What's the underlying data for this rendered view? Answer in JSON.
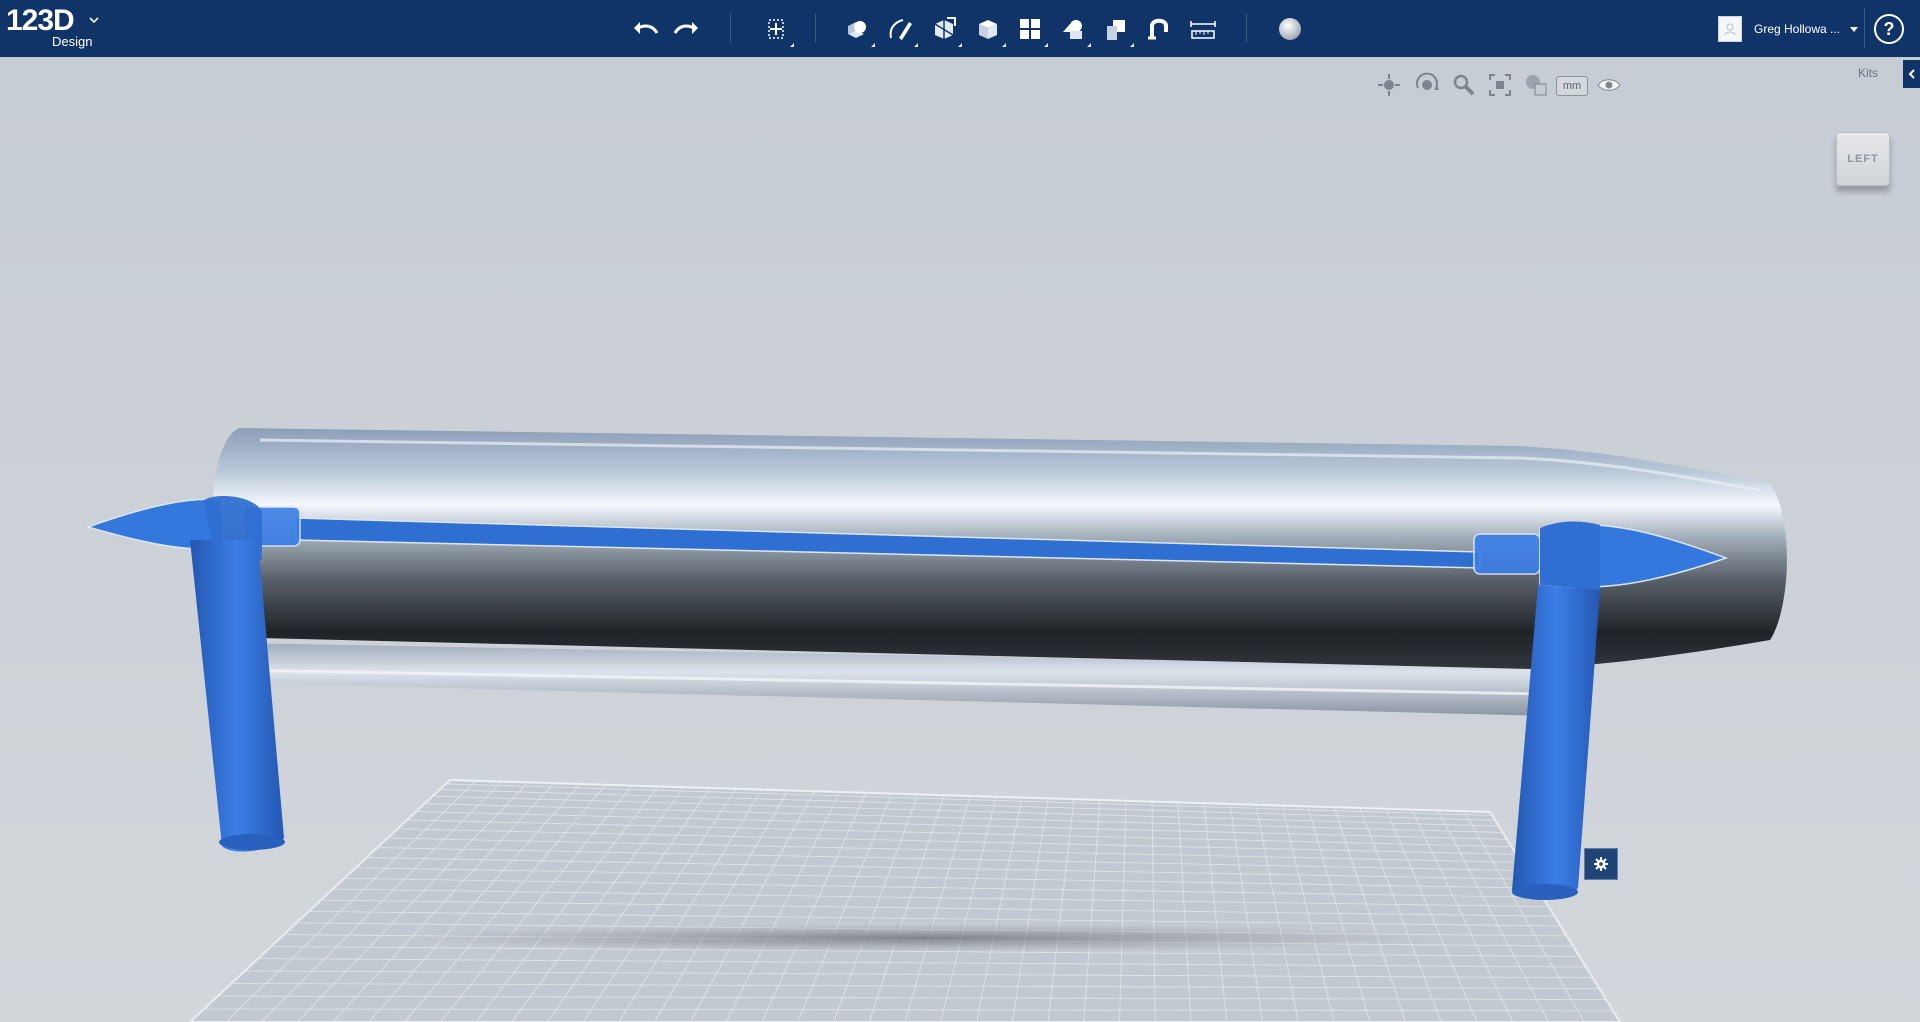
{
  "app": {
    "logo_text": "123D",
    "logo_sub": "Design"
  },
  "toolbar": {
    "items": [
      {
        "name": "undo-button",
        "icon": "undo-icon"
      },
      {
        "name": "redo-button",
        "icon": "redo-icon"
      },
      {
        "name": "transform-button",
        "icon": "transform-icon"
      },
      {
        "name": "primitives-button",
        "icon": "primitives-icon"
      },
      {
        "name": "sketch-button",
        "icon": "sketch-icon"
      },
      {
        "name": "construct-button",
        "icon": "construct-icon"
      },
      {
        "name": "modify-button",
        "icon": "modify-icon"
      },
      {
        "name": "pattern-button",
        "icon": "pattern-icon"
      },
      {
        "name": "grouping-button",
        "icon": "grouping-icon"
      },
      {
        "name": "combine-button",
        "icon": "combine-icon"
      },
      {
        "name": "snap-button",
        "icon": "snap-icon"
      },
      {
        "name": "measure-button",
        "icon": "measure-icon"
      },
      {
        "name": "material-button",
        "icon": "material-sphere-icon"
      }
    ]
  },
  "user": {
    "name": "Greg Hollowa ..."
  },
  "help_label": "?",
  "navbar": {
    "items": [
      "pan-icon",
      "orbit-icon",
      "zoom-icon",
      "fit-icon",
      "view-mode-icon",
      "visibility-icon"
    ],
    "units_label": "mm"
  },
  "kits": {
    "label": "Kits"
  },
  "viewcube": {
    "face_label": "LEFT"
  },
  "colors": {
    "topbar": "#103467",
    "selection_blue": "#2f6fd1",
    "viewport_bg": "#c9ced5",
    "grid": "#e9ecef"
  }
}
